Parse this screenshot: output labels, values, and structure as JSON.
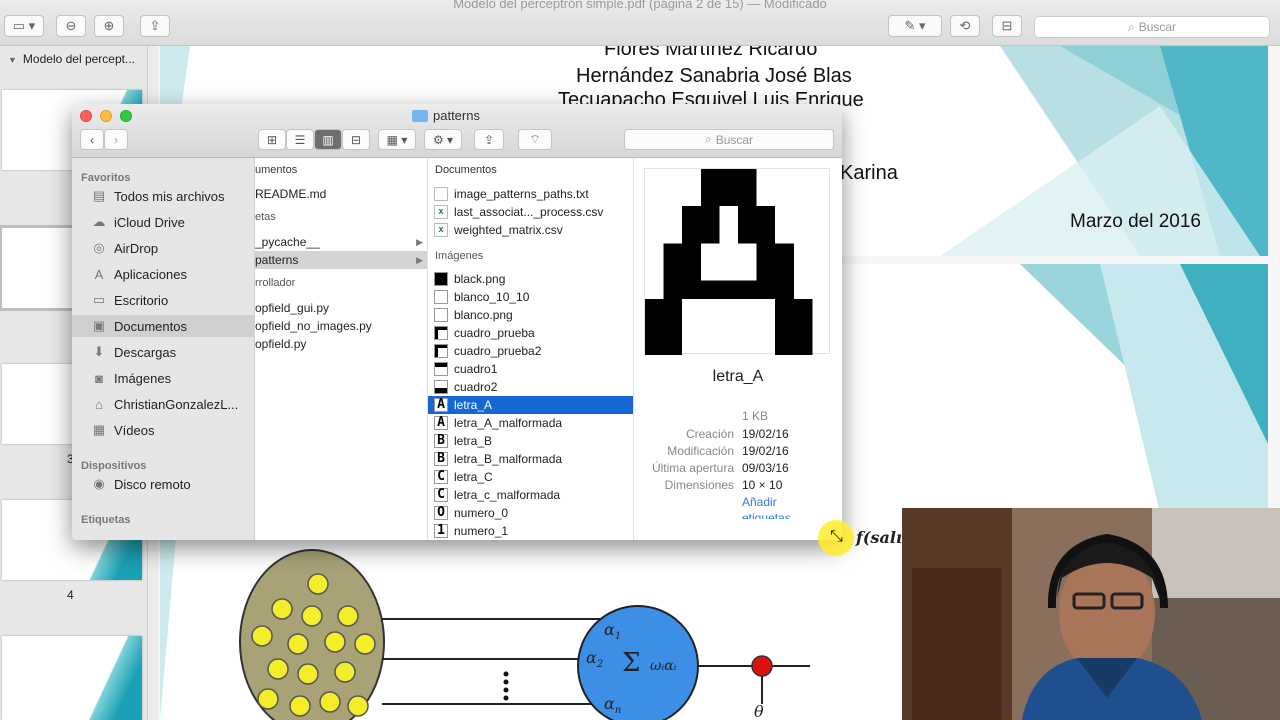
{
  "preview": {
    "title": "Modelo del perceptrón simple.pdf (página 2 de 15) — Modificado",
    "search_placeholder": "Buscar",
    "sidebar_title": "Modelo del percept...",
    "page_numbers": [
      "3",
      "4"
    ]
  },
  "document": {
    "names": [
      "Flores Martínez Ricardo",
      "Hernández Sanabria José Blas",
      "Tecuapacho Esquivel Luis Enrique"
    ],
    "name_fragment": "Karina",
    "date": "Marzo del 2016",
    "formula_fragment": "f(salı"
  },
  "finder": {
    "title": "patterns",
    "search_placeholder": "Buscar",
    "sidebar": {
      "favorites_label": "Favoritos",
      "favorites": [
        {
          "label": "Todos mis archivos",
          "icon": "all-files-icon"
        },
        {
          "label": "iCloud Drive",
          "icon": "cloud-icon"
        },
        {
          "label": "AirDrop",
          "icon": "airdrop-icon"
        },
        {
          "label": "Aplicaciones",
          "icon": "applications-icon"
        },
        {
          "label": "Escritorio",
          "icon": "desktop-icon"
        },
        {
          "label": "Documentos",
          "icon": "documents-icon"
        },
        {
          "label": "Descargas",
          "icon": "downloads-icon"
        },
        {
          "label": "Imágenes",
          "icon": "camera-icon"
        },
        {
          "label": "ChristianGonzalezL...",
          "icon": "home-icon"
        },
        {
          "label": "Vídeos",
          "icon": "film-icon"
        }
      ],
      "devices_label": "Dispositivos",
      "devices": [
        {
          "label": "Disco remoto",
          "icon": "disc-icon"
        }
      ],
      "tags_label": "Etiquetas"
    },
    "col1": {
      "head": "umentos",
      "readme": "README.md",
      "folders_label": "etas",
      "folders": [
        "_pycache__",
        "patterns"
      ],
      "dev_label": "rrollador",
      "files": [
        "opfield_gui.py",
        "opfield_no_images.py",
        "opfield.py"
      ]
    },
    "col2": {
      "head": "Documentos",
      "docs": [
        "image_patterns_paths.txt",
        "last_associat..._process.csv",
        "weighted_matrix.csv"
      ],
      "images_label": "Imágenes",
      "images": [
        "black.png",
        "blanco_10_10",
        "blanco.png",
        "cuadro_prueba",
        "cuadro_prueba2",
        "cuadro1",
        "cuadro2",
        "letra_A",
        "letra_A_malformada",
        "letra_B",
        "letra_B_malformada",
        "letra_C",
        "letra_c_malformada",
        "numero_0",
        "numero_1"
      ]
    },
    "preview": {
      "name": "letra_A",
      "size": "1 KB",
      "meta": [
        {
          "k": "Creación",
          "v": "19/02/16"
        },
        {
          "k": "Modificación",
          "v": "19/02/16"
        },
        {
          "k": "Última apertura",
          "v": "09/03/16"
        },
        {
          "k": "Dimensiones",
          "v": "10 × 10"
        }
      ],
      "add_tags": "Añadir",
      "tags_cut": "etiquetas..."
    }
  },
  "diagram": {
    "alpha1": "α",
    "alpha1_sub": "1",
    "alpha2": "α",
    "alpha2_sub": "2",
    "alphan": "α",
    "alphan_sub": "n",
    "sum": "Σ",
    "sum_expr": "ωᵢαᵢ",
    "theta": "θ"
  }
}
